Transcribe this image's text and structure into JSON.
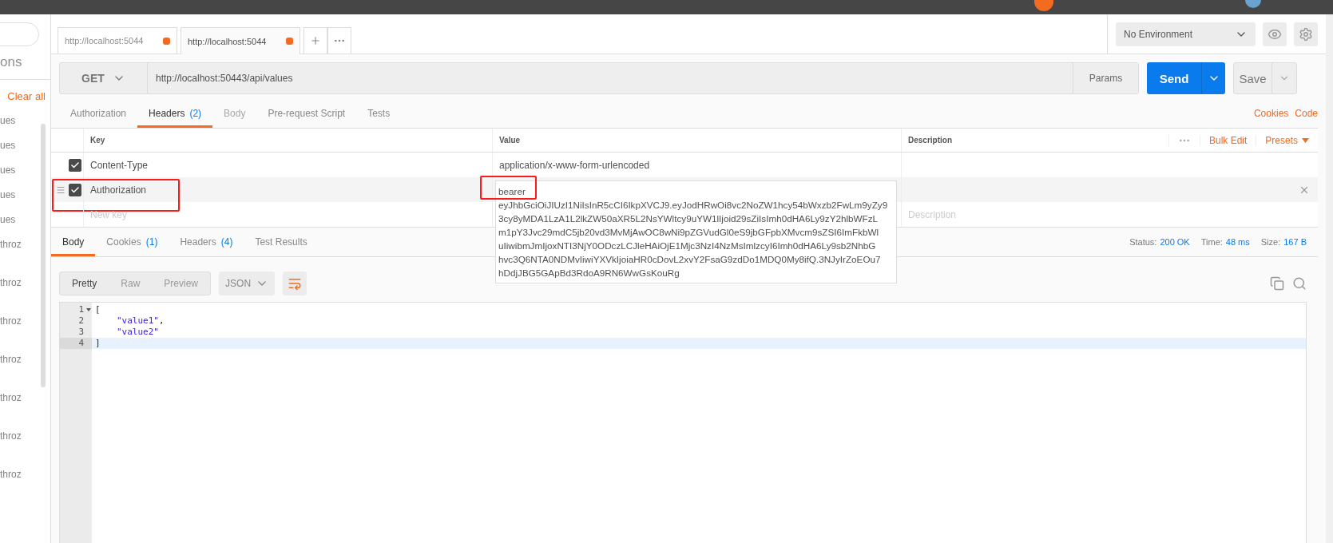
{
  "sidebar": {
    "heading": "ons",
    "clear_all": "Clear all",
    "items": [
      {
        "label": "ues"
      },
      {
        "label": "ues"
      },
      {
        "label": "ues"
      },
      {
        "label": "ues"
      },
      {
        "label": "ues"
      },
      {
        "label": "throz"
      },
      {
        "label": "throz"
      },
      {
        "label": "throz"
      },
      {
        "label": "throz"
      },
      {
        "label": "throz"
      },
      {
        "label": "throz"
      },
      {
        "label": "throz"
      }
    ]
  },
  "tabs": [
    {
      "label": "http://localhost:5044",
      "selected": false,
      "modified": true
    },
    {
      "label": "http://localhost:5044",
      "selected": true,
      "modified": true
    }
  ],
  "environment": "No Environment",
  "request": {
    "method": "GET",
    "url": "http://localhost:50443/api/values",
    "params": "Params",
    "send": "Send",
    "save": "Save"
  },
  "request_tabs": [
    {
      "label": "Authorization",
      "selected": false,
      "disabled": false
    },
    {
      "label": "Headers",
      "count": "(2)",
      "selected": true,
      "disabled": false
    },
    {
      "label": "Body",
      "selected": false,
      "disabled": true
    },
    {
      "label": "Pre-request Script",
      "selected": false,
      "disabled": false
    },
    {
      "label": "Tests",
      "selected": false,
      "disabled": false
    }
  ],
  "links": [
    "Cookies",
    "Code"
  ],
  "headers_table": {
    "columns": [
      "Key",
      "Value",
      "Description"
    ],
    "bulk_edit": "Bulk Edit",
    "presets": "Presets",
    "rows": [
      {
        "checked": true,
        "key": "Content-Type",
        "annotated": false,
        "editing": false,
        "value_lines": [
          "application/x-www-form-urlencoded"
        ]
      },
      {
        "checked": true,
        "key": "Authorization",
        "annotated": true,
        "editing": true,
        "value_lines": [
          "bearer",
          "eyJhbGciOiJIUzI1NiIsInR5cCI6IkpXVCJ9.eyJodHRwOi8vc2NoZW1hcy54bWxzb2FwLm9yZy9",
          "3cy8yMDA1LzA1L2lkZW50aXR5L2NsYWltcy9uYW1lIjoid29sZiIsImh0dHA6Ly9zY2hlbWFzL",
          "m1pY3Jvc29mdC5jb20vd3MvMjAwOC8wNi9pZGVudGl0eS9jbGFpbXMvcm9sZSI6ImFkbWl",
          "uIiwibmJmIjoxNTI3NjY0ODczLCJleHAiOjE1Mjc3NzI4NzMsImlzcyI6Imh0dHA6Ly9sb2NhbG",
          "hvc3Q6NTA0NDMvIiwiYXVkIjoiaHR0cDovL2xvY2FsaG9zdDo1MDQ0My8ifQ.3NJyIrZoEOu7",
          "hDdjJBG5GApBd3RdoA9RN6WwGsKouRg"
        ]
      }
    ],
    "new_key_placeholder": "New key",
    "new_description_placeholder": "Description"
  },
  "response": {
    "tabs": [
      {
        "label": "Body",
        "selected": true
      },
      {
        "label": "Cookies",
        "count": "(1)",
        "selected": false
      },
      {
        "label": "Headers",
        "count": "(4)",
        "selected": false
      },
      {
        "label": "Test Results",
        "selected": false
      }
    ],
    "stats": [
      {
        "label": "Status:",
        "value": "200 OK"
      },
      {
        "label": "Time:",
        "value": "48 ms"
      },
      {
        "label": "Size:",
        "value": "167 B"
      }
    ],
    "views": [
      {
        "label": "Pretty",
        "selected": true
      },
      {
        "label": "Raw",
        "selected": false
      },
      {
        "label": "Preview",
        "selected": false
      }
    ],
    "format": "JSON",
    "lines": [
      {
        "number": "1",
        "foldable": true,
        "current": false,
        "indented": false,
        "tokens": [
          {
            "kind": "punct",
            "text": "["
          }
        ]
      },
      {
        "number": "2",
        "foldable": false,
        "current": false,
        "indented": true,
        "tokens": [
          {
            "kind": "string",
            "text": "\"value1\""
          },
          {
            "kind": "punct",
            "text": ","
          }
        ]
      },
      {
        "number": "3",
        "foldable": false,
        "current": false,
        "indented": true,
        "tokens": [
          {
            "kind": "string",
            "text": "\"value2\""
          }
        ]
      },
      {
        "number": "4",
        "foldable": false,
        "current": true,
        "indented": false,
        "tokens": [
          {
            "kind": "punct",
            "text": "]"
          }
        ]
      }
    ]
  }
}
